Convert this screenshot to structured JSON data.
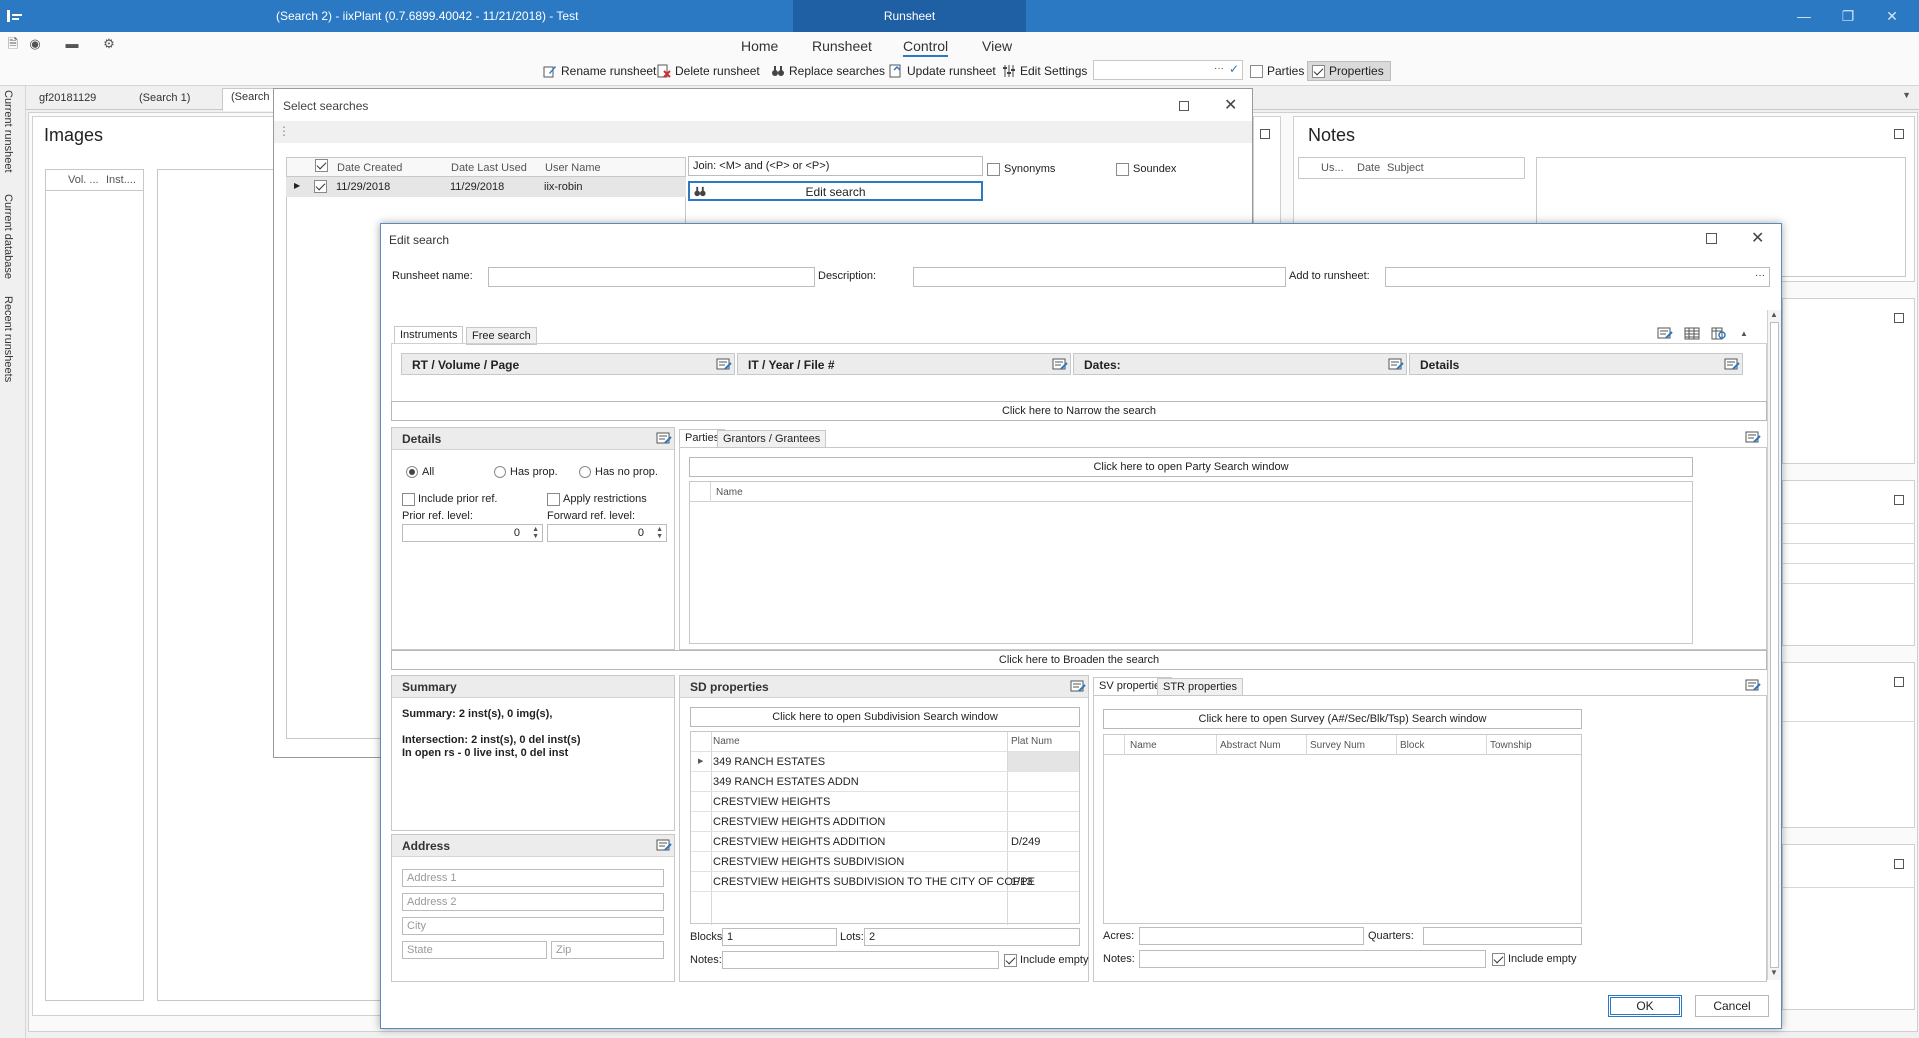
{
  "titlebar": {
    "title": "(Search 2) - iixPlant (0.7.6899.40042 - 11/21/2018) - Test",
    "context_tab": "Runsheet"
  },
  "ribbon": {
    "tabs": [
      "Home",
      "Runsheet",
      "Control",
      "View"
    ],
    "active_tab": "Control",
    "buttons": {
      "rename": "Rename runsheet",
      "delete": "Delete runsheet",
      "replace": "Replace searches",
      "update": "Update runsheet",
      "edit_settings": "Edit Settings",
      "parties": "Parties",
      "properties": "Properties"
    },
    "combo_ellipsis": "···"
  },
  "side_tabs": [
    "Current runsheet",
    "Current database",
    "Recent runsheets"
  ],
  "doc_tabs": [
    "gf20181129",
    "(Search 1)",
    "(Search"
  ],
  "images_panel": {
    "title": "Images",
    "columns": [
      "Vol. ...",
      "Inst...."
    ]
  },
  "notes_panel": {
    "title": "Notes",
    "columns": [
      "Us...",
      "Date",
      "Subject"
    ]
  },
  "select_searches": {
    "title": "Select searches",
    "grip": "⋮",
    "columns": [
      "Date Created",
      "Date Last Used",
      "User Name"
    ],
    "row": {
      "date_created": "11/29/2018",
      "date_last_used": "11/29/2018",
      "user": "iix-robin"
    },
    "join_text": "Join: <M> and (<P> or <P>)",
    "synonyms": "Synonyms",
    "soundex": "Soundex",
    "edit_search_btn": "Edit search"
  },
  "edit_search": {
    "title": "Edit search",
    "runsheet_name_label": "Runsheet name:",
    "description_label": "Description:",
    "add_to_runsheet_label": "Add to runsheet:",
    "add_to_runsheet_ellipsis": "···",
    "tabs": [
      "Instruments",
      "Free search"
    ],
    "sections": [
      "RT / Volume / Page",
      "IT / Year / File #",
      "Dates:",
      "Details"
    ],
    "narrow": "Click here to Narrow the search",
    "broaden": "Click here to Broaden the search",
    "details": {
      "title": "Details",
      "radio_all": "All",
      "radio_has_prop": "Has prop.",
      "radio_has_no_prop": "Has no prop.",
      "include_prior": "Include prior ref.",
      "apply_restrictions": "Apply restrictions",
      "prior_level_label": "Prior ref. level:",
      "forward_level_label": "Forward ref. level:",
      "prior_level": "0",
      "forward_level": "0"
    },
    "parties": {
      "tabs": [
        "Parties",
        "Grantors / Grantees"
      ],
      "open_btn": "Click here to open Party Search window",
      "name_col": "Name"
    },
    "summary": {
      "title": "Summary",
      "line1": "Summary: 2 inst(s), 0 img(s),",
      "line2": "Intersection: 2 inst(s), 0 del inst(s)",
      "line3": "In open rs - 0 live inst, 0 del inst"
    },
    "address": {
      "title": "Address",
      "address1": "Address 1",
      "address2": "Address 2",
      "city": "City",
      "state": "State",
      "zip": "Zip"
    },
    "sd": {
      "title": "SD properties",
      "open_btn": "Click here to open Subdivision Search window",
      "columns": [
        "Name",
        "Plat Num"
      ],
      "rows": [
        {
          "name": "349 RANCH ESTATES",
          "plat": ""
        },
        {
          "name": "349 RANCH ESTATES ADDN",
          "plat": ""
        },
        {
          "name": "CRESTVIEW HEIGHTS",
          "plat": ""
        },
        {
          "name": "CRESTVIEW HEIGHTS ADDITION",
          "plat": ""
        },
        {
          "name": "CRESTVIEW HEIGHTS ADDITION",
          "plat": "D/249"
        },
        {
          "name": "CRESTVIEW HEIGHTS SUBDIVISION",
          "plat": ""
        },
        {
          "name": "CRESTVIEW HEIGHTS SUBDIVISION TO THE CITY OF COPPE",
          "plat": "1/13"
        }
      ],
      "blocks_label": "Blocks:",
      "blocks": "1",
      "lots_label": "Lots:",
      "lots": "2",
      "notes_label": "Notes:",
      "include_empty": "Include empty"
    },
    "sv": {
      "tabs": [
        "SV properties",
        "STR properties"
      ],
      "open_btn": "Click here to open Survey (A#/Sec/Blk/Tsp) Search window",
      "columns": [
        "Name",
        "Abstract Num",
        "Survey Num",
        "Block",
        "Township"
      ],
      "acres_label": "Acres:",
      "quarters_label": "Quarters:",
      "notes_label": "Notes:",
      "include_empty": "Include empty"
    },
    "ok": "OK",
    "cancel": "Cancel"
  },
  "colors": {
    "titlebar": "#2b79c2",
    "accent": "#2b79c2"
  }
}
